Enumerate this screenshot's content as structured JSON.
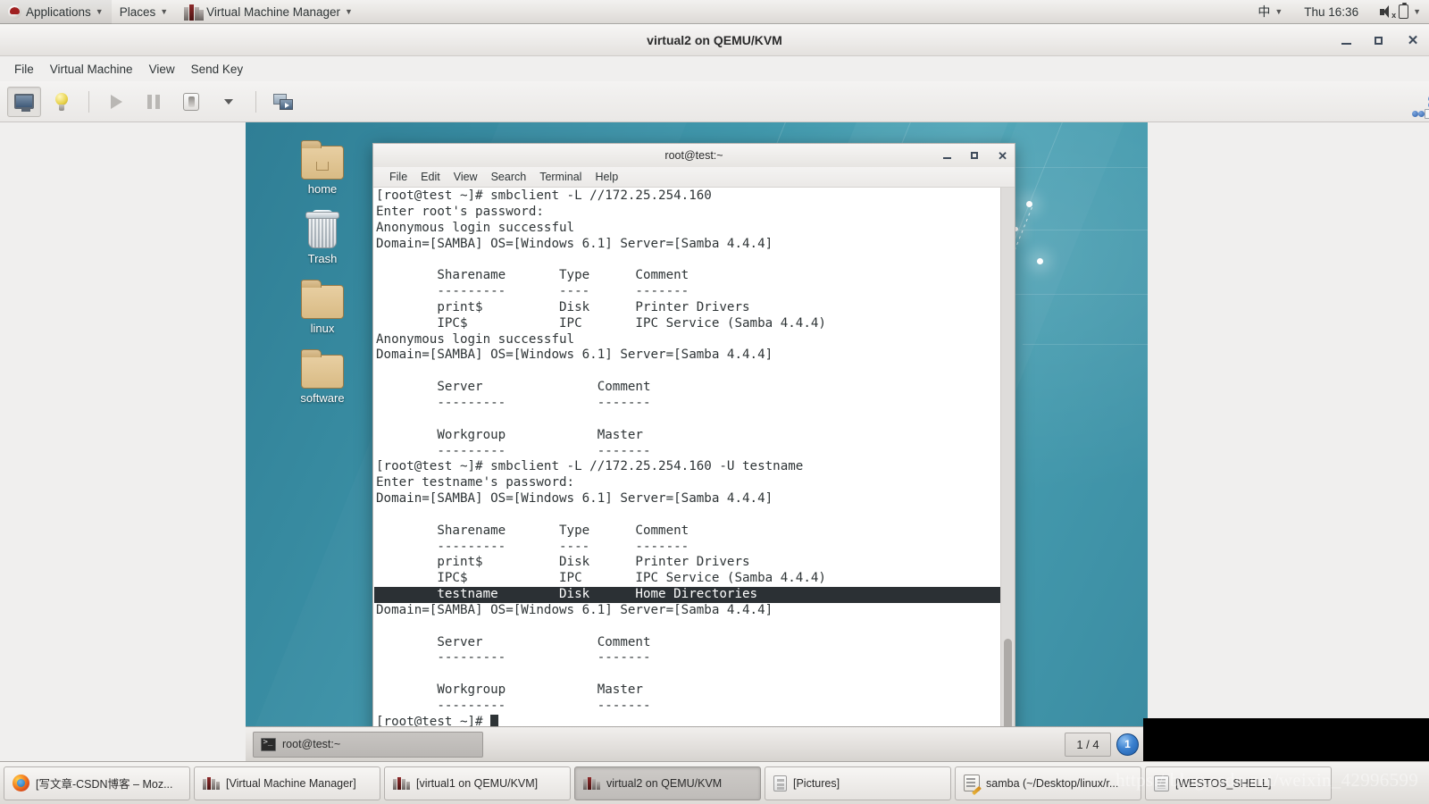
{
  "top_panel": {
    "applications_label": "Applications",
    "places_label": "Places",
    "active_app_label": "Virtual Machine Manager",
    "input_method": "中",
    "clock": "Thu 16:36",
    "icons": {
      "redhat": "redhat-logo-icon",
      "vmm": "virtual-machine-manager-icon",
      "volume": "volume-muted-icon",
      "battery": "battery-icon"
    }
  },
  "vmm_window": {
    "title": "virtual2 on QEMU/KVM",
    "menu": [
      "File",
      "Virtual Machine",
      "View",
      "Send Key"
    ],
    "toolbar": [
      {
        "name": "show-graphical-console",
        "icon": "monitor-icon",
        "active": true
      },
      {
        "name": "show-virtual-hardware-details",
        "icon": "lightbulb-icon",
        "active": false
      },
      {
        "name": "run",
        "icon": "play-icon",
        "active": false
      },
      {
        "name": "pause",
        "icon": "pause-icon",
        "active": false
      },
      {
        "name": "shutdown",
        "icon": "power-icon",
        "active": false
      },
      {
        "name": "shutdown-menu",
        "icon": "chevron-down-icon",
        "active": false
      },
      {
        "name": "manage-snapshots",
        "icon": "screens-icon",
        "active": false
      }
    ],
    "resize_icon": "fullscreen-resize-icon",
    "window_controls": {
      "minimize": "_",
      "maximize": "□",
      "close": "✕"
    }
  },
  "vm_desktop": {
    "icons": [
      {
        "label": "home",
        "icon": "home-folder-icon"
      },
      {
        "label": "Trash",
        "icon": "trash-icon"
      },
      {
        "label": "linux",
        "icon": "folder-icon"
      },
      {
        "label": "software",
        "icon": "folder-icon"
      }
    ],
    "taskbar": {
      "task_label": "root@test:~",
      "task_icon": "terminal-icon",
      "workspace_indicator": "1 / 4",
      "workspace_badge": "1"
    }
  },
  "terminal": {
    "title": "root@test:~",
    "menu": [
      "File",
      "Edit",
      "View",
      "Search",
      "Terminal",
      "Help"
    ],
    "window_controls": {
      "minimize": "_",
      "maximize": "□",
      "close": "✕"
    },
    "lines": [
      {
        "text": "[root@test ~]# smbclient -L //172.25.254.160",
        "highlight": false
      },
      {
        "text": "Enter root's password:",
        "highlight": false
      },
      {
        "text": "Anonymous login successful",
        "highlight": false
      },
      {
        "text": "Domain=[SAMBA] OS=[Windows 6.1] Server=[Samba 4.4.4]",
        "highlight": false
      },
      {
        "text": "",
        "highlight": false
      },
      {
        "text": "        Sharename       Type      Comment",
        "highlight": false
      },
      {
        "text": "        ---------       ----      -------",
        "highlight": false
      },
      {
        "text": "        print$          Disk      Printer Drivers",
        "highlight": false
      },
      {
        "text": "        IPC$            IPC       IPC Service (Samba 4.4.4)",
        "highlight": false
      },
      {
        "text": "Anonymous login successful",
        "highlight": false
      },
      {
        "text": "Domain=[SAMBA] OS=[Windows 6.1] Server=[Samba 4.4.4]",
        "highlight": false
      },
      {
        "text": "",
        "highlight": false
      },
      {
        "text": "        Server               Comment",
        "highlight": false
      },
      {
        "text": "        ---------            -------",
        "highlight": false
      },
      {
        "text": "",
        "highlight": false
      },
      {
        "text": "        Workgroup            Master",
        "highlight": false
      },
      {
        "text": "        ---------            -------",
        "highlight": false
      },
      {
        "text": "[root@test ~]# smbclient -L //172.25.254.160 -U testname",
        "highlight": false
      },
      {
        "text": "Enter testname's password:",
        "highlight": false
      },
      {
        "text": "Domain=[SAMBA] OS=[Windows 6.1] Server=[Samba 4.4.4]",
        "highlight": false
      },
      {
        "text": "",
        "highlight": false
      },
      {
        "text": "        Sharename       Type      Comment",
        "highlight": false
      },
      {
        "text": "        ---------       ----      -------",
        "highlight": false
      },
      {
        "text": "        print$          Disk      Printer Drivers",
        "highlight": false
      },
      {
        "text": "        IPC$            IPC       IPC Service (Samba 4.4.4)",
        "highlight": false
      },
      {
        "text": "        testname        Disk      Home Directories",
        "highlight": true
      },
      {
        "text": "Domain=[SAMBA] OS=[Windows 6.1] Server=[Samba 4.4.4]",
        "highlight": false
      },
      {
        "text": "",
        "highlight": false
      },
      {
        "text": "        Server               Comment",
        "highlight": false
      },
      {
        "text": "        ---------            -------",
        "highlight": false
      },
      {
        "text": "",
        "highlight": false
      },
      {
        "text": "        Workgroup            Master",
        "highlight": false
      },
      {
        "text": "        ---------            -------",
        "highlight": false
      }
    ],
    "prompt": "[root@test ~]# "
  },
  "host_taskbar": {
    "tasks": [
      {
        "label": "[写文章-CSDN博客 – Moz...",
        "icon": "firefox-icon",
        "active": false
      },
      {
        "label": "[Virtual Machine Manager]",
        "icon": "vmm-icon",
        "active": false
      },
      {
        "label": "[virtual1 on QEMU/KVM]",
        "icon": "vmm-icon",
        "active": false
      },
      {
        "label": "virtual2 on QEMU/KVM",
        "icon": "vmm-icon",
        "active": true
      },
      {
        "label": "[Pictures]",
        "icon": "pictures-icon",
        "active": false
      },
      {
        "label": "samba (~/Desktop/linux/r...",
        "icon": "gedit-icon",
        "active": false
      },
      {
        "label": "[WESTOS_SHELL]",
        "icon": "shell-icon",
        "active": false
      }
    ]
  },
  "watermark": "https://blog.csdn.net/weixin_42996599"
}
